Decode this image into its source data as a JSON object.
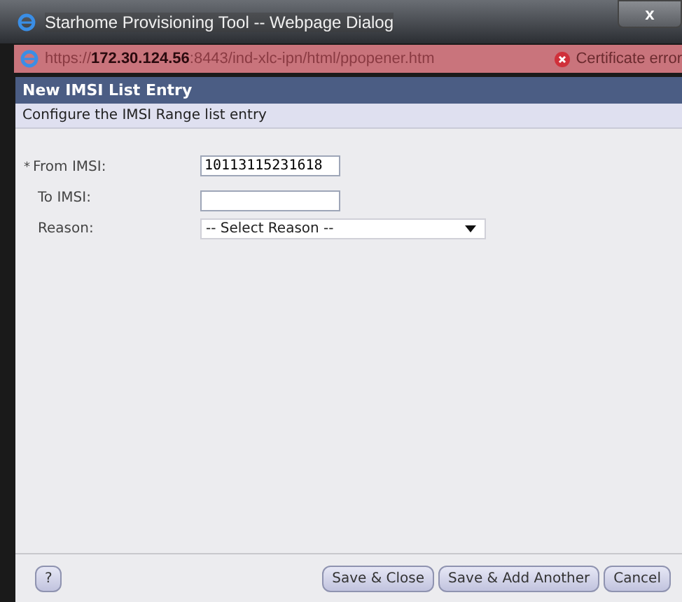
{
  "window": {
    "title": "Starhome Provisioning Tool -- Webpage Dialog",
    "close": "x"
  },
  "address_bar": {
    "url": "https://**172.30.124.56**:8443/ind-xlc-ipn/html/ppopener.htm",
    "warning": "Certificate error"
  },
  "dialog": {
    "title": "New IMSI List Entry",
    "subtitle": "Configure the IMSI Range list entry"
  },
  "fields": [
    {
      "kind": "text",
      "label": "From IMSI:",
      "required_mark": "*",
      "value": "10113115231618"
    },
    {
      "kind": "text",
      "label": "To IMSI:"
    },
    {
      "kind": "select",
      "label": "Reason:",
      "value": "-- Select Reason --"
    }
  ],
  "help_button": "?",
  "buttons": [
    "Save & Close",
    "Save & Add Another",
    "Cancel"
  ]
}
